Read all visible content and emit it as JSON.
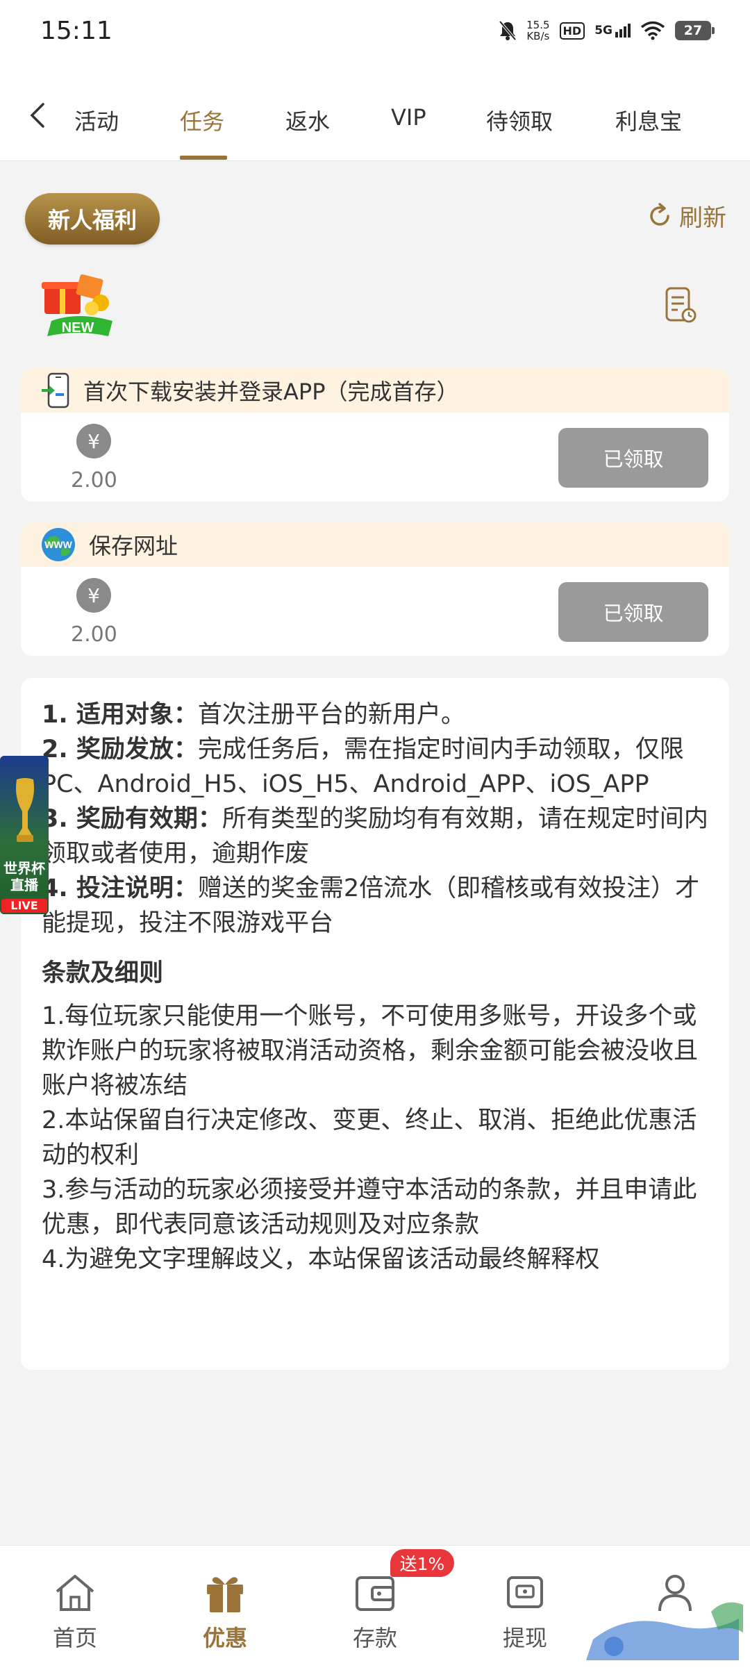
{
  "status_bar": {
    "time": "15:11",
    "net_speed_value": "15.5",
    "net_speed_unit": "KB/s",
    "hd_label": "HD",
    "network_label": "5G",
    "battery": "27"
  },
  "tabs": [
    {
      "label": "活动"
    },
    {
      "label": "任务"
    },
    {
      "label": "返水"
    },
    {
      "label": "VIP"
    },
    {
      "label": "待领取"
    },
    {
      "label": "利息宝"
    }
  ],
  "section": {
    "badge_label": "新人福利",
    "refresh_label": "刷新",
    "new_tag": "NEW"
  },
  "tasks": [
    {
      "title": "首次下载安装并登录APP（完成首存）",
      "currency_symbol": "¥",
      "amount": "2.00",
      "button_label": "已领取"
    },
    {
      "title": "保存网址",
      "currency_symbol": "¥",
      "amount": "2.00",
      "button_label": "已领取",
      "icon_text": "WWW"
    }
  ],
  "rules": [
    {
      "label": "1. 适用对象：",
      "text": "首次注册平台的新用户。"
    },
    {
      "label": "2. 奖励发放：",
      "text": "完成任务后，需在指定时间内手动领取，仅限PC、Android_H5、iOS_H5、Android_APP、iOS_APP"
    },
    {
      "label": "3. 奖励有效期：",
      "text": "所有类型的奖励均有有效期，请在规定时间内领取或者使用，逾期作废"
    },
    {
      "label": "4. 投注说明：",
      "text": "赠送的奖金需2倍流水（即稽核或有效投注）才能提现，投注不限游戏平台"
    }
  ],
  "terms": {
    "title": "条款及细则",
    "items": [
      "1.每位玩家只能使用一个账号，不可使用多账号，开设多个或欺诈账户的玩家将被取消活动资格，剩余金额可能会被没收且账户将被冻结",
      "2.本站保留自行决定修改、变更、终止、取消、拒绝此优惠活动的权利",
      "3.参与活动的玩家必须接受并遵守本活动的条款，并且申请此优惠，即代表同意该活动规则及对应条款",
      "4.为避免文字理解歧义，本站保留该活动最终解释权"
    ]
  },
  "floating_widget": {
    "title": "世界杯直播",
    "live_label": "LIVE"
  },
  "bottom_nav": [
    {
      "label": "首页"
    },
    {
      "label": "优惠"
    },
    {
      "label": "存款"
    },
    {
      "label": "提现"
    }
  ],
  "deposit_badge": "送1%",
  "colors": {
    "accent": "#9a7339",
    "card_head_bg": "#fdf3e0",
    "claimed_button": "#9a9a9a",
    "badge_red": "#e8363a"
  }
}
